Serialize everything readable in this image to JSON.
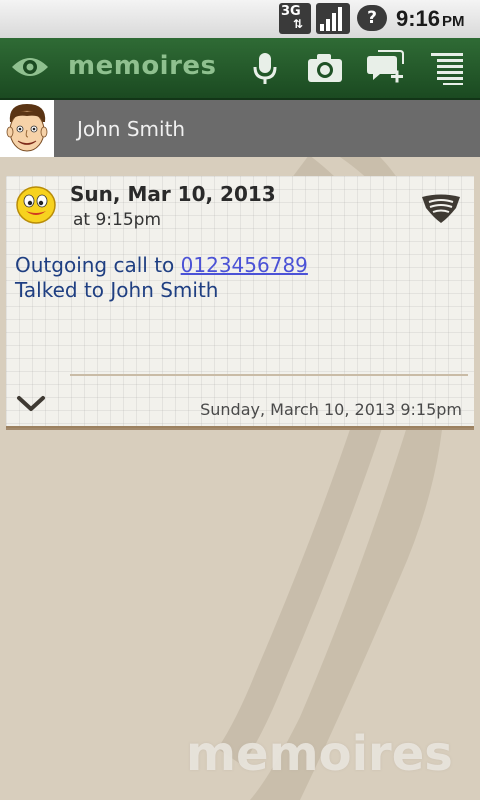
{
  "status_bar": {
    "network": "3G",
    "time": "9:16",
    "ampm": "PM"
  },
  "app_bar": {
    "title": "memoires",
    "icons": [
      "eye-icon",
      "microphone-icon",
      "camera-icon",
      "new-message-icon",
      "menu-icon"
    ]
  },
  "contact": {
    "name": "John Smith"
  },
  "card": {
    "date": "Sun, Mar 10, 2013",
    "time": "at 9:15pm",
    "line1_prefix": "Outgoing call to ",
    "phone": "0123456789",
    "line2": "Talked to John Smith",
    "footer": "Sunday, March 10, 2013 9:15pm"
  },
  "watermark": "memoires",
  "colors": {
    "app_bar": "#1b4a21",
    "contact_bar": "#6b6b6b",
    "background": "#d8cebd",
    "body_text": "#1f3f82",
    "link": "#4b52d6"
  }
}
